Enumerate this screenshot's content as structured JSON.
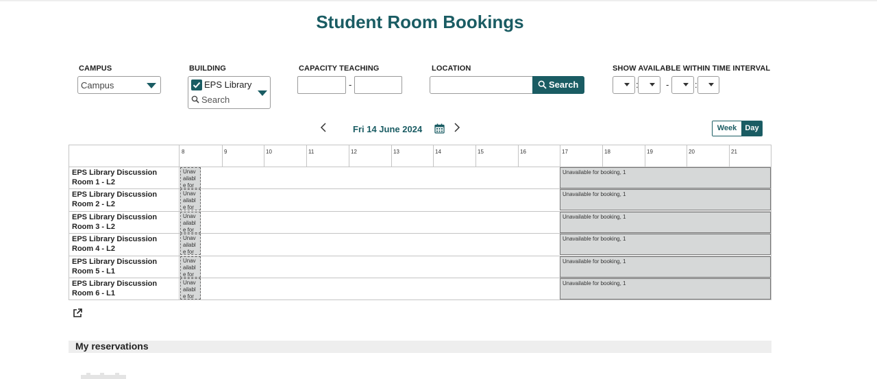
{
  "page": {
    "title": "Student Room Bookings"
  },
  "filters": {
    "campus": {
      "label": "CAMPUS",
      "value": "Campus"
    },
    "building": {
      "label": "BUILDING",
      "selected": "EPS Library",
      "search_placeholder": "Search"
    },
    "capacity": {
      "label": "CAPACITY TEACHING",
      "separator": "-"
    },
    "location": {
      "label": "LOCATION",
      "search_label": "Search"
    },
    "time_interval": {
      "label": "SHOW AVAILABLE WITHIN TIME INTERVAL",
      "colon": ":",
      "separator": "-"
    }
  },
  "calendar": {
    "date": "Fri 14 June 2024",
    "view_week": "Week",
    "view_day": "Day",
    "active_view": "Day",
    "hours": [
      "8",
      "9",
      "10",
      "11",
      "12",
      "13",
      "14",
      "15",
      "16",
      "17",
      "18",
      "19",
      "20",
      "21"
    ],
    "rooms": [
      {
        "name": "EPS Library Discussion Room 1 - L2",
        "early": "Unav ailabl e for",
        "late": "Unavailable for booking, 1"
      },
      {
        "name": "EPS Library Discussion Room 2 - L2",
        "early": "Unav ailabl e for",
        "late": "Unavailable for booking, 1"
      },
      {
        "name": "EPS Library Discussion Room 3 - L2",
        "early": "Unav ailabl e for",
        "late": "Unavailable for booking, 1"
      },
      {
        "name": "EPS Library Discussion Room 4 - L2",
        "early": "Unav ailabl e for",
        "late": "Unavailable for booking, 1"
      },
      {
        "name": "EPS Library Discussion Room 5 - L1",
        "early": "Unav ailabl e for",
        "late": "Unavailable for booking, 1"
      },
      {
        "name": "EPS Library Discussion Room 6 - L1",
        "early": "Unav ailabl e for",
        "late": "Unavailable for booking, 1"
      }
    ]
  },
  "reservations": {
    "title": "My reservations"
  },
  "colors": {
    "accent": "#1a5c63",
    "unavailable": "#d6d8d8",
    "grid": "#c4c4c4"
  }
}
